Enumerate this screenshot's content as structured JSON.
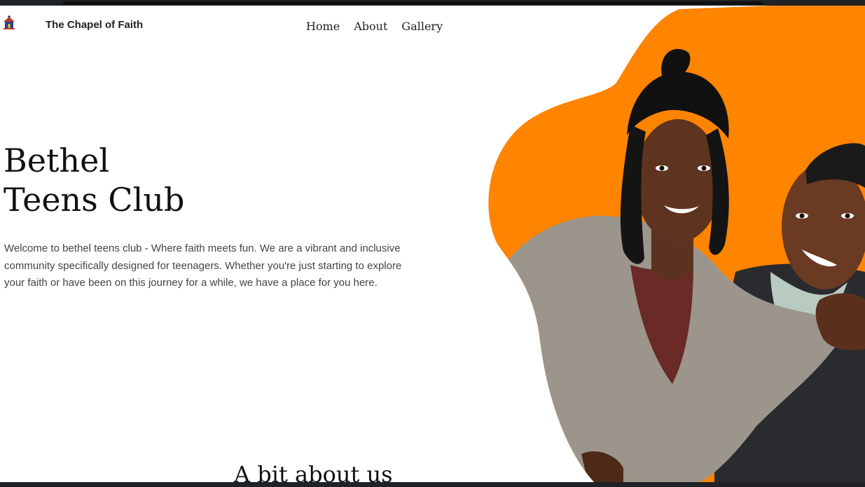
{
  "header": {
    "logo_icon": "church-logo-icon",
    "site_name": "The Chapel of Faith",
    "nav": [
      {
        "label": "Home"
      },
      {
        "label": "About"
      },
      {
        "label": "Gallery"
      }
    ]
  },
  "hero": {
    "title_line1": "Bethel",
    "title_line2": "Teens Club",
    "description": "Welcome to bethel teens club - Where faith meets fun. We are a vibrant and inclusive community specifically designed for teenagers. Whether you're just starting to explore your faith or have been on this journey for a while, we have a place for you here.",
    "image": "photo of two smiling teenage girls hugging",
    "accent_color": "#ff8400"
  },
  "about": {
    "heading": "A bit about us"
  }
}
